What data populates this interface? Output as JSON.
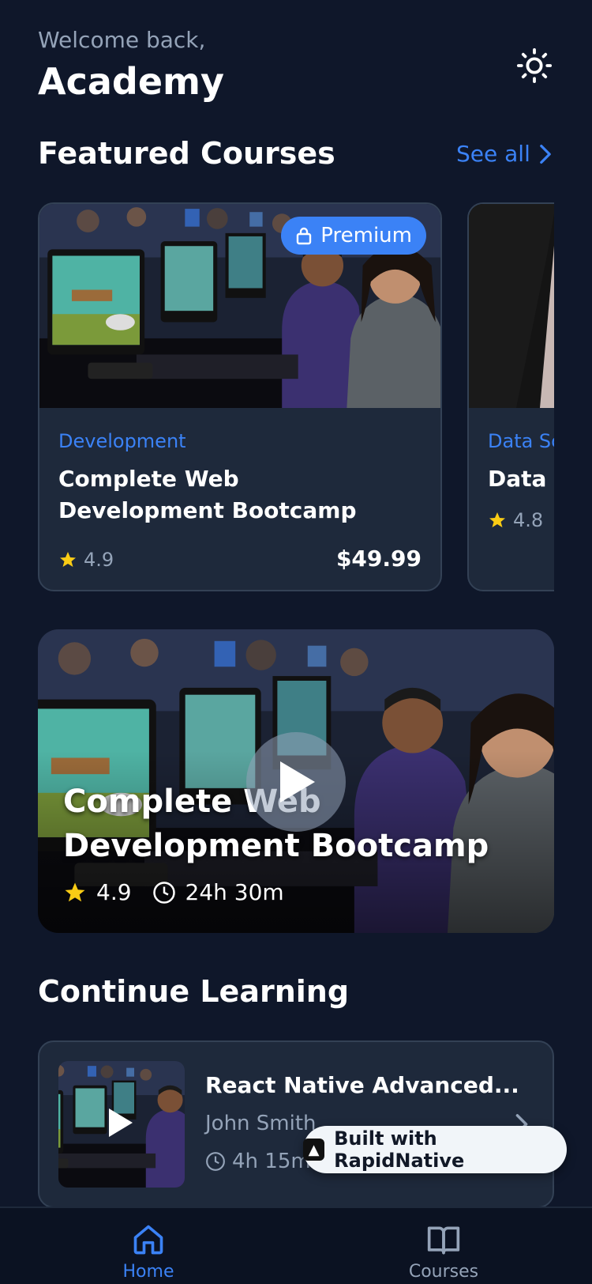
{
  "header": {
    "welcome": "Welcome back,",
    "title": "Academy"
  },
  "featured": {
    "title": "Featured Courses",
    "see_all": "See all",
    "courses": [
      {
        "category": "Development",
        "title": "Complete Web Development Bootcamp",
        "rating": "4.9",
        "price": "$49.99",
        "badge": "Premium"
      },
      {
        "category": "Data Sc",
        "title": "Data S",
        "rating": "4.8"
      }
    ]
  },
  "hero": {
    "title": "Complete Web Development Bootcamp",
    "rating": "4.9",
    "duration": "24h 30m"
  },
  "continue_learning": {
    "title": "Continue Learning",
    "course": {
      "title": "React Native Advanced...",
      "author": "John Smith",
      "duration": "4h 15m"
    }
  },
  "badge": {
    "label": "Built with RapidNative"
  },
  "tabs": [
    {
      "label": "Home",
      "icon": "home-icon",
      "active": true
    },
    {
      "label": "Courses",
      "icon": "book-icon",
      "active": false
    }
  ],
  "colors": {
    "background": "#0f172a",
    "card": "#1e293b",
    "accent": "#3b82f6",
    "star": "#facc15",
    "muted": "#94a3b8"
  }
}
